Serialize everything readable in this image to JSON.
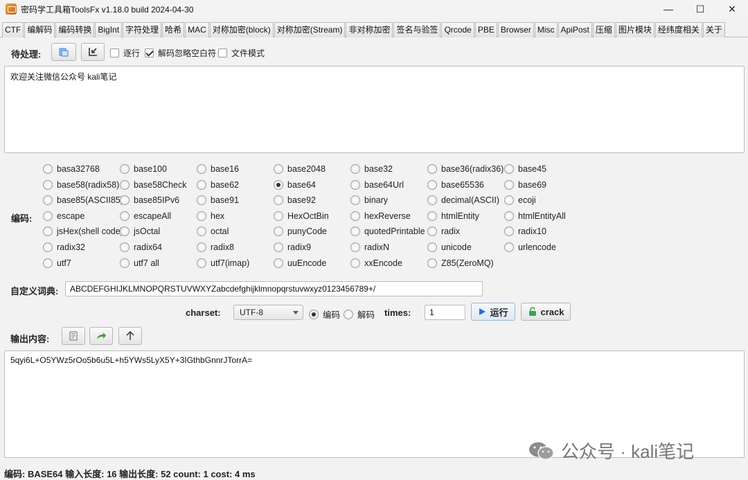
{
  "window": {
    "title": "密码学工具箱ToolsFx v1.18.0 build 2024-04-30",
    "minimize": "—",
    "maximize": "☐",
    "close": "✕"
  },
  "tabs": [
    "CTF",
    "编解码",
    "编码转换",
    "BigInt",
    "字符处理",
    "哈希",
    "MAC",
    "对称加密(block)",
    "对称加密(Stream)",
    "非对称加密",
    "签名与验签",
    "Qrcode",
    "PBE",
    "Browser",
    "Misc",
    "ApiPost",
    "压缩",
    "图片模块",
    "经纬度相关",
    "关于"
  ],
  "active_tab": "编解码",
  "input": {
    "label": "待处理:",
    "options": {
      "line_by_line": "逐行",
      "ignore_whitespace": "解码忽略空白符",
      "file_mode": "文件模式"
    },
    "option_state": {
      "line_by_line": false,
      "ignore_whitespace": true,
      "file_mode": false
    },
    "text": "欢迎关注微信公众号 kali笔记"
  },
  "encoding": {
    "label": "编码:",
    "selected": "base64",
    "options": [
      [
        "basa32768",
        "base100",
        "base16",
        "base2048",
        "base32",
        "base36(radix36)",
        "base45"
      ],
      [
        "base58(radix58)",
        "base58Check",
        "base62",
        "base64",
        "base64Url",
        "base65536",
        "base69"
      ],
      [
        "base85(ASCII85)",
        "base85IPv6",
        "base91",
        "base92",
        "binary",
        "decimal(ASCII)",
        "ecoji"
      ],
      [
        "escape",
        "escapeAll",
        "hex",
        "HexOctBin",
        "hexReverse",
        "htmlEntity",
        "htmlEntityAll"
      ],
      [
        "jsHex(shell code)",
        "jsOctal",
        "octal",
        "punyCode",
        "quotedPrintable",
        "radix",
        "radix10"
      ],
      [
        "radix32",
        "radix64",
        "radix8",
        "radix9",
        "radixN",
        "unicode",
        "urlencode"
      ],
      [
        "utf7",
        "utf7 all",
        "utf7(imap)",
        "uuEncode",
        "xxEncode",
        "Z85(ZeroMQ)"
      ]
    ]
  },
  "dictionary": {
    "label": "自定义词典:",
    "value": "ABCDEFGHIJKLMNOPQRSTUVWXYZabcdefghijklmnopqrstuvwxyz0123456789+/"
  },
  "controls": {
    "charset_label": "charset:",
    "charset_value": "UTF-8",
    "encode_label": "编码",
    "decode_label": "解码",
    "mode": "encode",
    "times_label": "times:",
    "times_value": "1",
    "run_label": "运行",
    "crack_label": "crack"
  },
  "output": {
    "label": "输出内容:",
    "text": "5qyi6L+O5YWz5rOo5b6u5L+h5YWs5LyX5Y+3IGthbGnnrJTorrA="
  },
  "status": {
    "text": "编码: BASE64  输入长度: 16  输出长度: 52 count: 1 cost: 4 ms"
  },
  "watermark": {
    "text": "公众号 · kali笔记"
  },
  "colors": {
    "run_icon": "#2a6fd1",
    "crack_icon": "#3aa34a",
    "copy_icon": "#3a7bd5",
    "share_icon": "#3f9c35"
  }
}
